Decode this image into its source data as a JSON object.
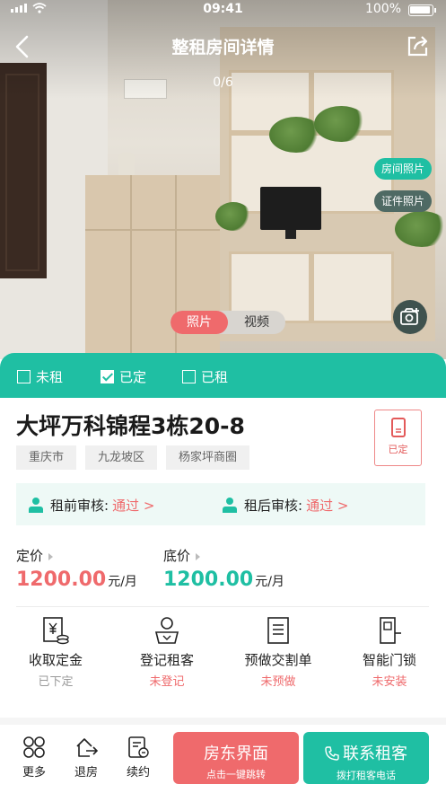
{
  "status_bar": {
    "time": "09:41",
    "battery": "100%"
  },
  "nav": {
    "title": "整租房间详情",
    "counter": "0/6"
  },
  "photo_tags": {
    "room_photos": "房间照片",
    "id_photos": "证件照片"
  },
  "media_toggle": {
    "photo": "照片",
    "video": "视频",
    "selected": "照片"
  },
  "rent_status": {
    "options": [
      {
        "label": "未租",
        "checked": false
      },
      {
        "label": "已定",
        "checked": true
      },
      {
        "label": "已租",
        "checked": false
      }
    ]
  },
  "listing": {
    "title": "大坪万科锦程3栋20-8",
    "tags": [
      "重庆市",
      "九龙坡区",
      "杨家坪商圈"
    ],
    "booked_badge": "已定"
  },
  "review": {
    "pre_label": "租前审核:",
    "pre_value": "通过 >",
    "post_label": "租后审核:",
    "post_value": "通过 >"
  },
  "prices": {
    "list_label": "定价",
    "list_value": "1200.00",
    "floor_label": "底价",
    "floor_value": "1200.00",
    "unit": "元/月"
  },
  "actions": [
    {
      "label": "收取定金",
      "status": "已下定"
    },
    {
      "label": "登记租客",
      "status": "未登记"
    },
    {
      "label": "预做交割单",
      "status": "未预做"
    },
    {
      "label": "智能门锁",
      "status": "未安装"
    }
  ],
  "bottom_bar": {
    "more": "更多",
    "checkout": "退房",
    "renew": "续约",
    "landlord_main": "房东界面",
    "landlord_sub": "点击一键跳转",
    "contact_main": "联系租客",
    "contact_sub": "拨打租客电话"
  },
  "colors": {
    "accent_green": "#1fbfa3",
    "accent_red": "#ef6a6c"
  }
}
